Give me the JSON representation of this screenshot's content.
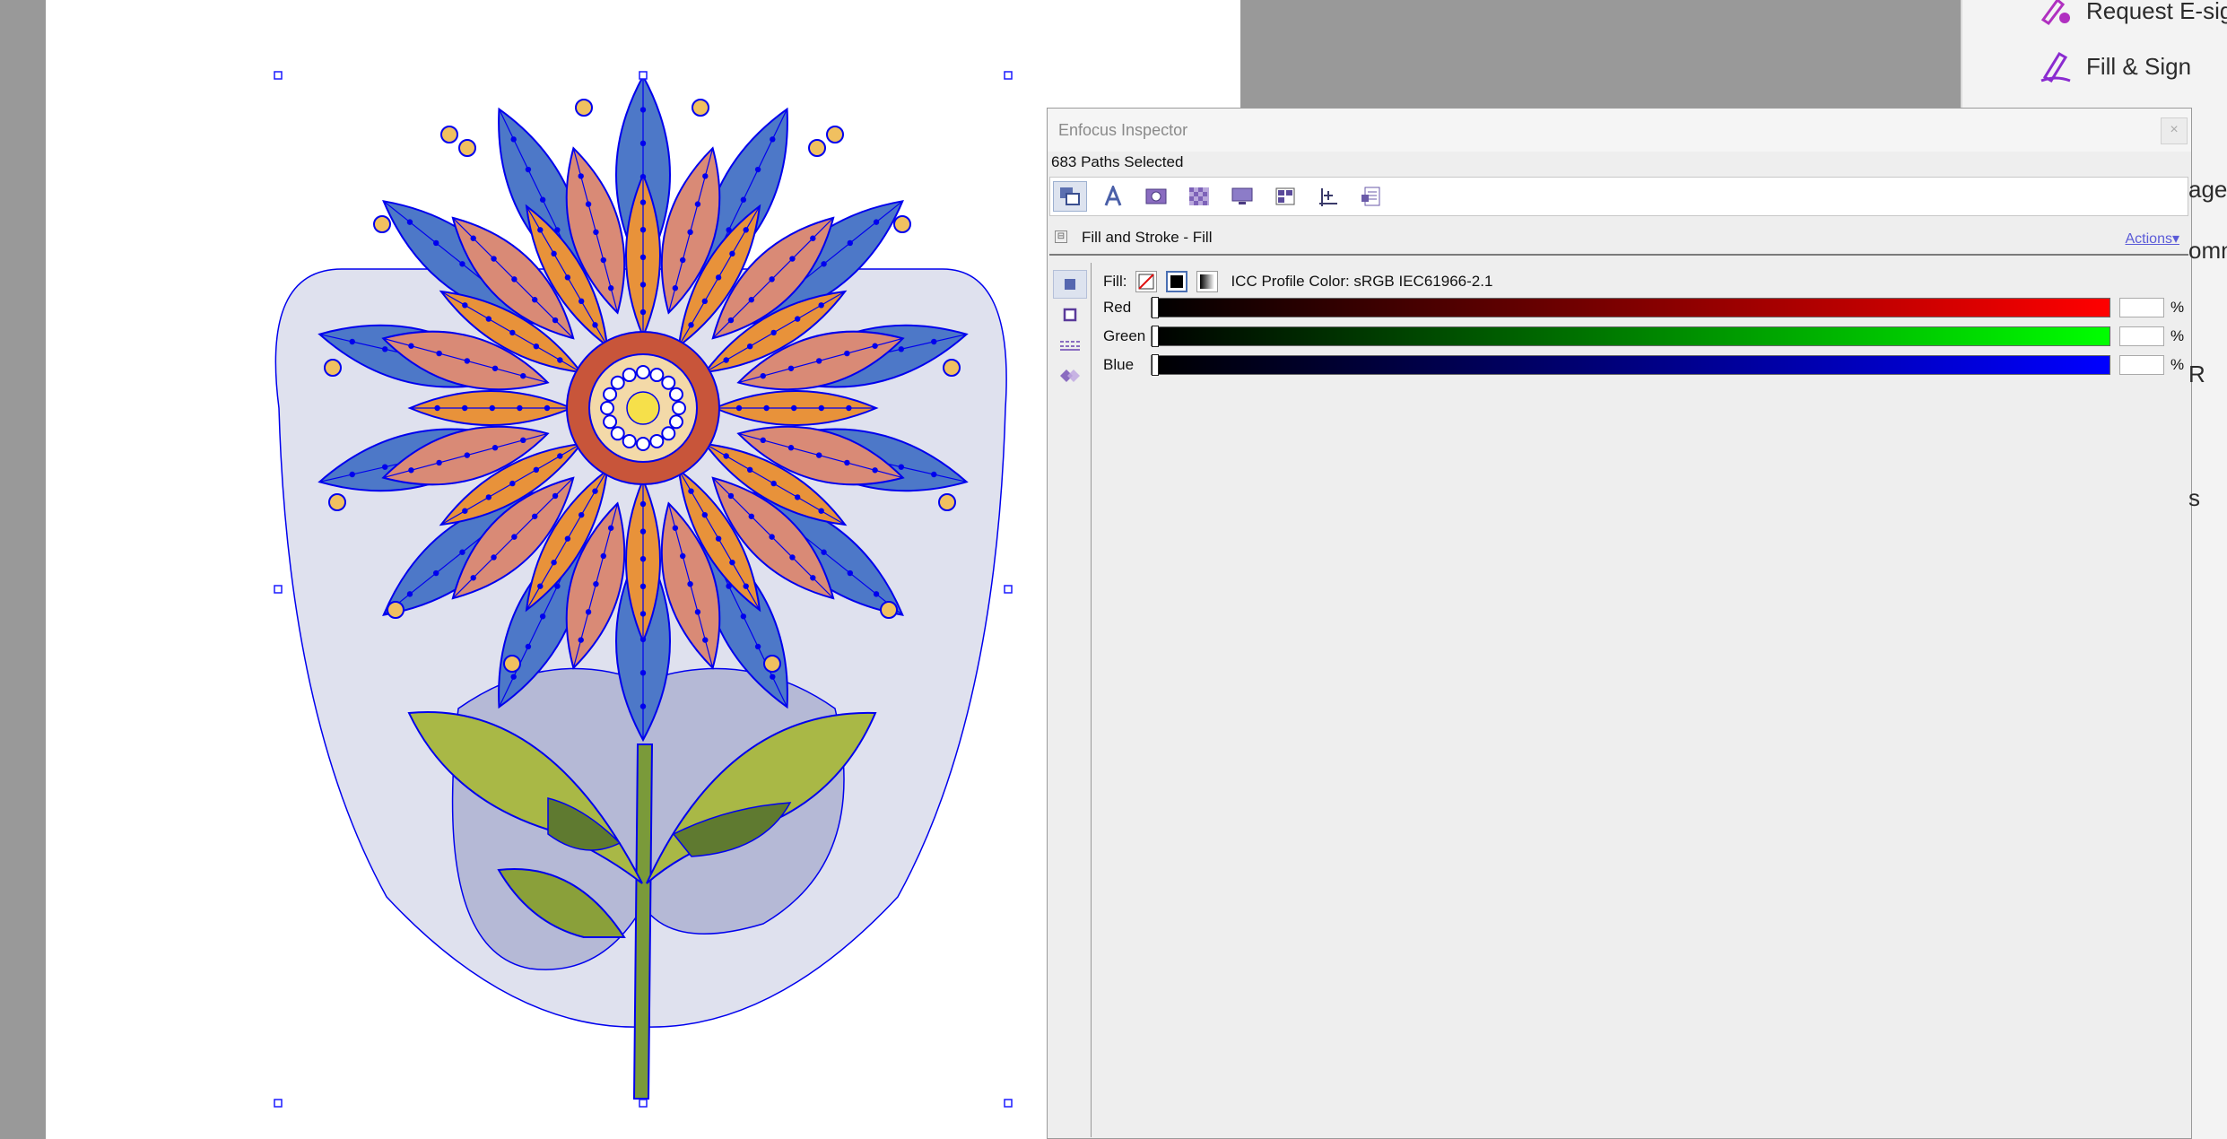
{
  "sidebar": {
    "request_esign": "Request E-sign",
    "fill_sign": "Fill & Sign",
    "clipped": [
      "age",
      "omn",
      "R",
      "s"
    ]
  },
  "inspector": {
    "title": "Enfocus Inspector",
    "close_glyph": "×",
    "selection_status": "683 Paths Selected",
    "toolbar_icons": [
      "fill-stroke-icon",
      "text-icon",
      "image-icon",
      "shading-icon",
      "output-icon",
      "layout-icon",
      "position-icon",
      "document-icon"
    ],
    "section_collapse_glyph": "⊟",
    "section_title": "Fill and Stroke - Fill",
    "actions_label": "Actions",
    "fill": {
      "label": "Fill:",
      "color_space": "ICC Profile Color: sRGB IEC61966-2.1"
    },
    "channels": [
      {
        "name": "Red",
        "value": "",
        "unit": "%",
        "color": "#ff0000",
        "level": 0
      },
      {
        "name": "Green",
        "value": "",
        "unit": "%",
        "color": "#00ff00",
        "level": 0
      },
      {
        "name": "Blue",
        "value": "",
        "unit": "%",
        "color": "#0000ff",
        "level": 0
      }
    ]
  },
  "colors": {
    "selection_blue": "#0000ee",
    "orange_petal": "#e8923a",
    "salmon_petal": "#d98a76",
    "blue_petal": "#4d78c8",
    "leaf_green": "#7a9a3a",
    "background_shape": "#dfe1ee"
  }
}
